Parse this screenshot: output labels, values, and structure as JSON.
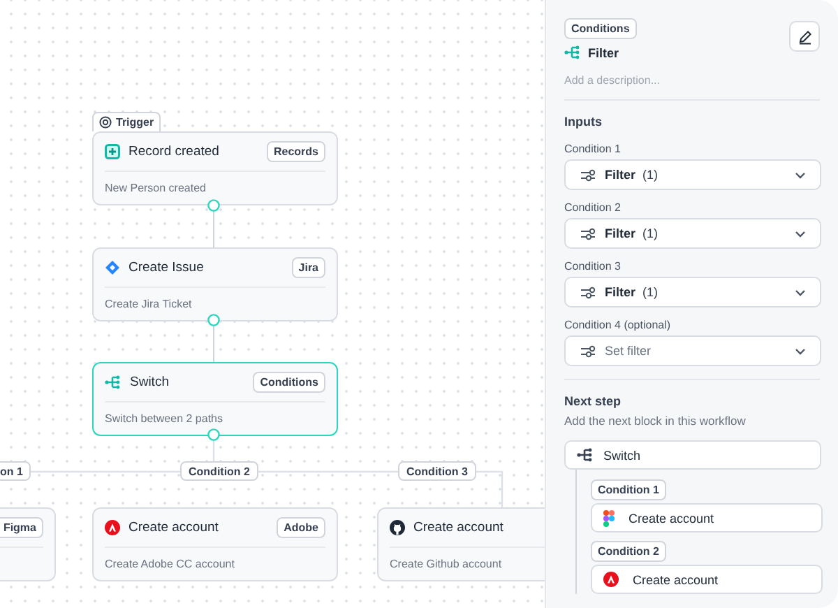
{
  "canvas": {
    "nodes": [
      {
        "tag": "Trigger",
        "title": "Record created",
        "badge": "Records",
        "subtitle": "New Person created",
        "selected": false
      },
      {
        "title": "Create Issue",
        "badge": "Jira",
        "subtitle": "Create Jira Ticket",
        "selected": false
      },
      {
        "title": "Switch",
        "badge": "Conditions",
        "subtitle": "Switch between 2 paths",
        "selected": true
      },
      {
        "badge": "Figma",
        "selected": false
      },
      {
        "title": "Create account",
        "badge": "Adobe",
        "subtitle": "Create Adobe CC account",
        "selected": false
      },
      {
        "title": "Create account",
        "subtitle": "Create Github account",
        "selected": false
      }
    ],
    "branch_labels": [
      "on 1",
      "Condition 2",
      "Condition 3"
    ]
  },
  "panel": {
    "badge": "Conditions",
    "title": "Filter",
    "description": {
      "placeholder": "Add a description..."
    },
    "inputs_heading": "Inputs",
    "conditions": [
      {
        "label": "Condition 1",
        "value": "Filter",
        "count": "(1)"
      },
      {
        "label": "Condition 2",
        "value": "Filter",
        "count": "(1)"
      },
      {
        "label": "Condition 3",
        "value": "Filter",
        "count": "(1)"
      },
      {
        "label": "Condition 4 (optional)",
        "placeholder": "Set filter"
      }
    ],
    "next_step": {
      "heading": "Next step",
      "subtitle": "Add the next block in this workflow",
      "block": "Switch",
      "branches": [
        {
          "label": "Condition 1",
          "title": "Create account"
        },
        {
          "label": "Condition 2",
          "title": "Create account"
        }
      ]
    }
  }
}
